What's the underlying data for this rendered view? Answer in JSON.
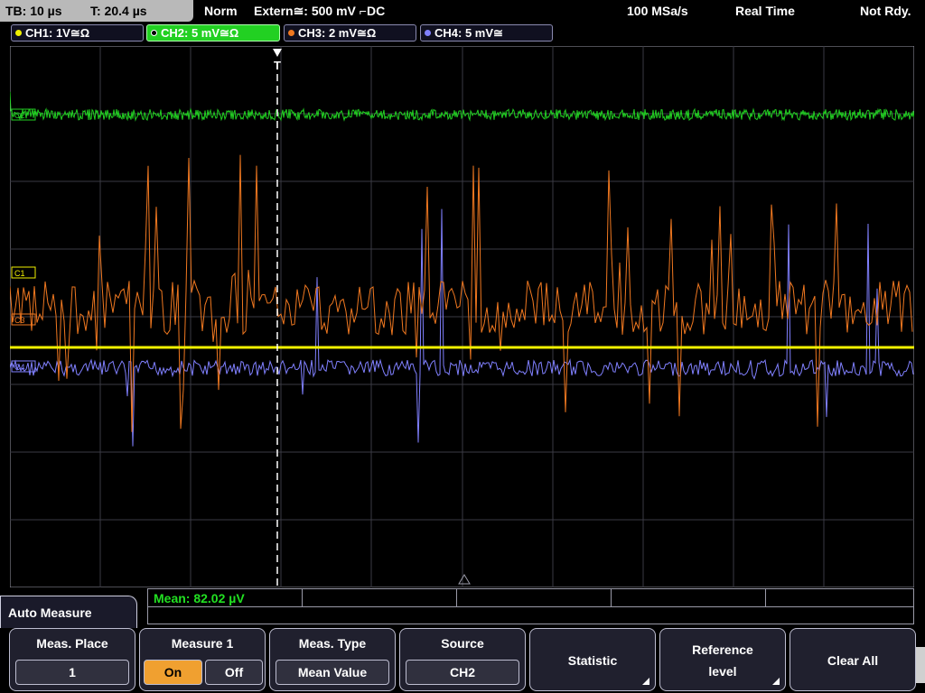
{
  "top": {
    "tb": "TB: 10 µs",
    "t": "T: 20.4 µs",
    "mode": "Norm",
    "trigger": "Extern≅: 500 mV ⌐DC",
    "rate": "100 MSa/s",
    "acq": "Real Time",
    "state": "Not Rdy."
  },
  "channels": [
    {
      "label": "CH1: 1V≅Ω",
      "color": "#f0f000"
    },
    {
      "label": "CH2: 5 mV≅Ω",
      "color": "#22d022"
    },
    {
      "label": "CH3: 2 mV≅Ω",
      "color": "#f07820"
    },
    {
      "label": "CH4: 5 mV≅",
      "color": "#8080ff"
    }
  ],
  "markers": {
    "c2": "C2",
    "c1": "C1",
    "c3": "C3",
    "c4": "C4",
    "trigger_t": "T"
  },
  "readout": {
    "mean": "Mean: 82.02 µV"
  },
  "panel": {
    "title": "Auto Measure"
  },
  "softkeys": {
    "meas_place": {
      "title": "Meas. Place",
      "value": "1"
    },
    "measure1": {
      "title": "Measure 1",
      "on": "On",
      "off": "Off"
    },
    "meas_type": {
      "title": "Meas. Type",
      "value": "Mean Value"
    },
    "source": {
      "title": "Source",
      "value": "CH2"
    },
    "statistic": {
      "title": "Statistic"
    },
    "reference": {
      "line1": "Reference",
      "line2": "level"
    },
    "clear_all": {
      "title": "Clear All"
    }
  }
}
